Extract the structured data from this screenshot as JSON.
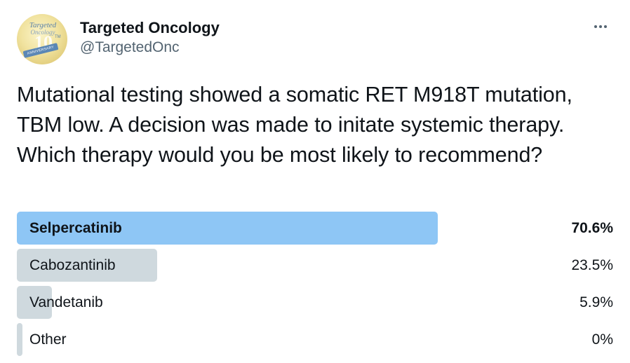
{
  "account": {
    "display_name": "Targeted Oncology",
    "handle": "@TargetedOnc",
    "avatar": {
      "logo_text": "Targeted",
      "logo_subtext": "Oncology",
      "logo_number": "10",
      "logo_tm": "TM",
      "ribbon_text": "ANNIVERSARY"
    }
  },
  "more_icon": "more-horizontal-icon",
  "tweet_text": "Mutational testing showed a somatic RET M918T mutation, TBM low. A decision was made to initate systemic therapy. Which therapy would you be most likely to recommend?",
  "poll": {
    "options": [
      {
        "label": "Selpercatinib",
        "percent_text": "70.6%",
        "percent": 70.6,
        "winner": true
      },
      {
        "label": "Cabozantinib",
        "percent_text": "23.5%",
        "percent": 23.5,
        "winner": false
      },
      {
        "label": "Vandetanib",
        "percent_text": "5.9%",
        "percent": 5.9,
        "winner": false
      },
      {
        "label": "Other",
        "percent_text": "0%",
        "percent": 0,
        "winner": false
      }
    ]
  },
  "colors": {
    "winner_bar": "#8ec6f5",
    "bar": "#cfd9de",
    "text": "#0f1419",
    "secondary_text": "#536471"
  }
}
